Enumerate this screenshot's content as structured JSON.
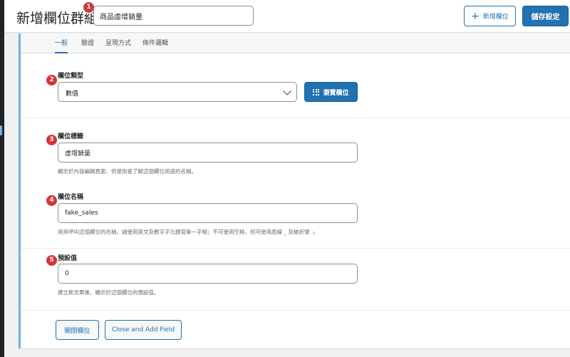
{
  "header": {
    "title": "新增欄位群組",
    "group_title_value": "商品虛增銷量",
    "add_field_label": "新增欄位",
    "save_label": "儲存設定"
  },
  "badges": [
    "1",
    "2",
    "3",
    "4",
    "5"
  ],
  "tabs": [
    {
      "label": "一般",
      "active": true
    },
    {
      "label": "驗證",
      "active": false
    },
    {
      "label": "呈現方式",
      "active": false
    },
    {
      "label": "條件邏輯",
      "active": false
    }
  ],
  "fields": {
    "field_type": {
      "label": "欄位類型",
      "selected_value": "數值",
      "browse_label": "瀏覽欄位"
    },
    "field_label": {
      "label": "欄位標籤",
      "value": "虛增銷量",
      "help": "顯示於內容編輯頁面、供使用者了解這個欄位用途的名稱。"
    },
    "field_name": {
      "label": "欄位名稱",
      "value": "fake_sales",
      "help": "用來呼叫這個欄位的名稱，請使用英文及數字字元撰寫單一字組；不可使用空格，但可使用底線 _ 及破折號 -。"
    },
    "default_value": {
      "label": "預設值",
      "value": "0",
      "help": "建立新文章後，顯示於這個欄位的預設值。"
    }
  },
  "footer_buttons": {
    "close_field_label": "關閉欄位",
    "close_add_label": "Close and Add Field"
  },
  "icons": {
    "add": "plus-icon",
    "browse": "grid-icon",
    "select": "chevron-down-icon"
  },
  "colors": {
    "accent": "#2271b1",
    "badge": "#d63638",
    "active_border": "#72aee6"
  }
}
